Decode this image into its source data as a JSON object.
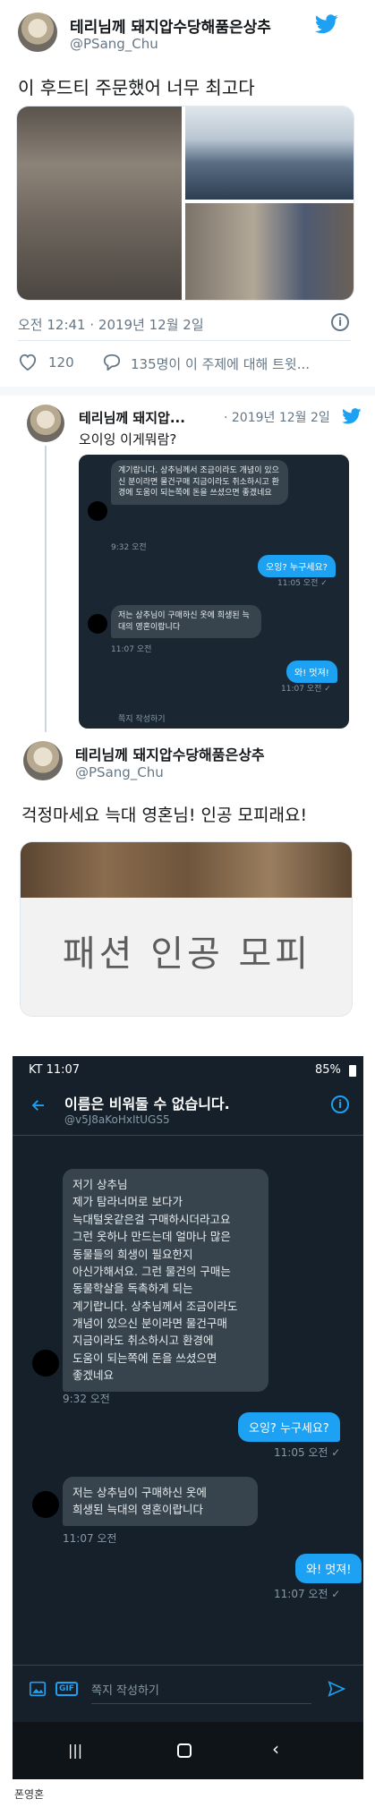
{
  "tweet1": {
    "name": "테리님께 돼지압수당해품은상추",
    "handle": "@PSang_Chu",
    "text": "이 후드티 주문했어 너무 최고다",
    "timestamp": "오전 12:41 · 2019년 12월 2일",
    "likes": "120",
    "talking": "135명이 이 주제에 대해 트윗..."
  },
  "tweet2": {
    "name": "테리님께 돼지압...",
    "date": "· 2019년 12월 2일",
    "text": "오이잉 이게뭐람?",
    "dm": {
      "msg1": "계기랍니다. 상추님께서 조금이라도 개념이 있으신 분이라면 물건구매 지금이라도 취소하시고 환경에 도움이 되는쪽에 돈을 쓰셨으면 좋겠네요",
      "time1": "9:32 오전",
      "out1": "오잉? 누구세요?",
      "time2": "11:05 오전 ✓",
      "msg2": "저는 상추님이 구매하신 옷에 희생된 늑대의 영혼이랍니다",
      "time3": "11:07 오전",
      "out2": "와! 멋져!",
      "time4": "11:07 오전 ✓",
      "compose": "쪽지 작성하기"
    }
  },
  "tweet3": {
    "name": "테리님께 돼지압수당해품은상추",
    "handle": "@PSang_Chu",
    "text": "걱정마세요 늑대 영혼님! 인공 모피래요!",
    "label_image_text": "패션 인공 모피"
  },
  "phone": {
    "status_time": "KT 11:07",
    "battery": "85%",
    "title": "이름은 비워둘 수 없습니다.",
    "handle": "@v5J8aKoHxItUGS5",
    "msg1": "저기 상추님\n제가 탐라너머로 보다가\n늑대털옷같은걸 구매하시더라고요\n그런 옷하나 만드는데 얼마나 많은\n동물들의 희생이 필요한지\n아신가해서요. 그런 물건의 구매는\n동물학살을 독촉하게 되는\n계기랍니다. 상추님께서 조금이라도\n개념이 있으신 분이라면 물건구매\n지금이라도 취소하시고 환경에\n도움이 되는쪽에 돈을 쓰셨으면\n좋겠네요",
    "time1": "9:32 오전",
    "out1": "오잉? 누구세요?",
    "time2": "11:05 오전 ✓",
    "msg2": "저는 상추님이 구매하신 옷에\n희생된 늑대의 영혼이랍니다",
    "time3": "11:07 오전",
    "out2": "와! 멋져!",
    "time4": "11:07 오전 ✓",
    "compose_placeholder": "쪽지 작성하기",
    "gif": "GIF"
  },
  "footer": {
    "caption": "폰영혼"
  }
}
